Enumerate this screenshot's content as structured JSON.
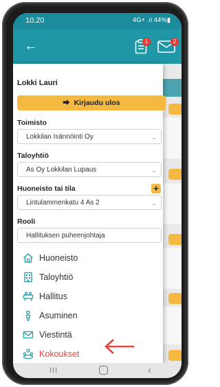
{
  "status_bar": {
    "time": "10.20",
    "system": "4G+ .ıl 44%▮"
  },
  "app_bar": {
    "back_icon": "arrow-left-icon",
    "tasks_badge": "1",
    "messages_badge": "2"
  },
  "drawer": {
    "user_name": "Lokki Lauri",
    "logout_label": "Kirjaudu ulos",
    "fields": [
      {
        "label": "Toimisto",
        "value": "Lokkilan Isännöinti Oy"
      },
      {
        "label": "Taloyhtiö",
        "value": "As Oy Lokkilan Lupaus"
      },
      {
        "label": "Huoneisto tai tila",
        "value": "Lintulammenkatu 4 As 2"
      },
      {
        "label": "Rooli",
        "value": "Hallituksen puheenjohtaja"
      }
    ],
    "add_label": "+",
    "menu": [
      {
        "label": "Huoneisto",
        "icon": "home-icon"
      },
      {
        "label": "Taloyhtiö",
        "icon": "building-icon"
      },
      {
        "label": "Hallitus",
        "icon": "board-icon"
      },
      {
        "label": "Asuminen",
        "icon": "person-icon"
      },
      {
        "label": "Viestintä",
        "icon": "envelope-icon"
      },
      {
        "label": "Kokoukset",
        "icon": "meeting-icon",
        "active": true
      }
    ]
  },
  "nav_bar": {
    "recent": "III",
    "back": "‹"
  },
  "colors": {
    "teal": "#1f97a7",
    "accent": "#f5b942",
    "active": "#e8453c",
    "icon": "#1f97a7"
  }
}
